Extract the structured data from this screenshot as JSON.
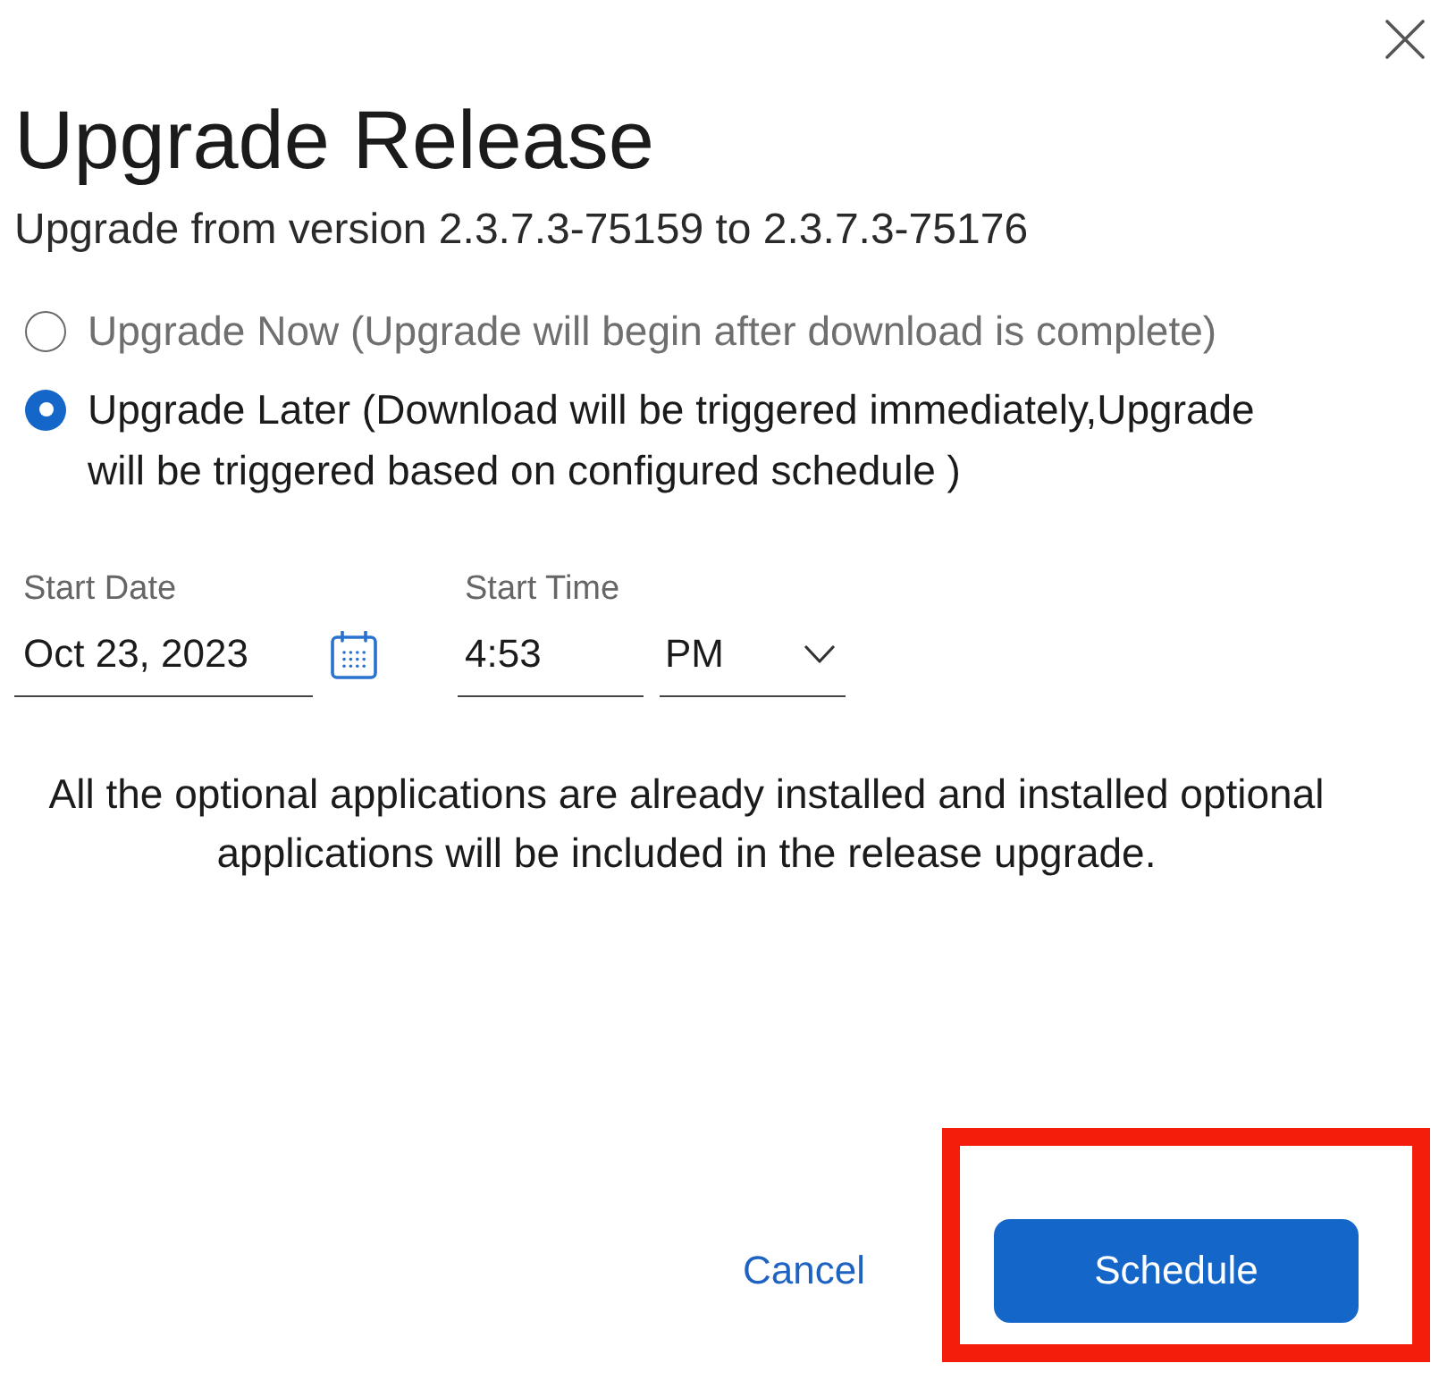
{
  "dialog": {
    "title": "Upgrade Release",
    "subtitle": "Upgrade from version 2.3.7.3-75159 to 2.3.7.3-75176"
  },
  "options": [
    {
      "label": "Upgrade Now (Upgrade will begin after download is complete)",
      "selected": false
    },
    {
      "label": "Upgrade Later (Download will be triggered immediately,Upgrade will be triggered based on configured schedule )",
      "selected": true
    }
  ],
  "fields": [
    {
      "kind": "date",
      "label": "Start Date",
      "value": "Oct 23, 2023"
    },
    {
      "kind": "time",
      "label": "Start Time",
      "value": "4:53"
    },
    {
      "kind": "select",
      "value": "PM"
    }
  ],
  "message": "All the optional applications are already installed and installed optional applications will be included in the release upgrade.",
  "buttons": [
    {
      "kind": "link",
      "label": "Cancel",
      "highlighted": false
    },
    {
      "kind": "primary",
      "label": "Schedule",
      "highlighted": true
    }
  ]
}
